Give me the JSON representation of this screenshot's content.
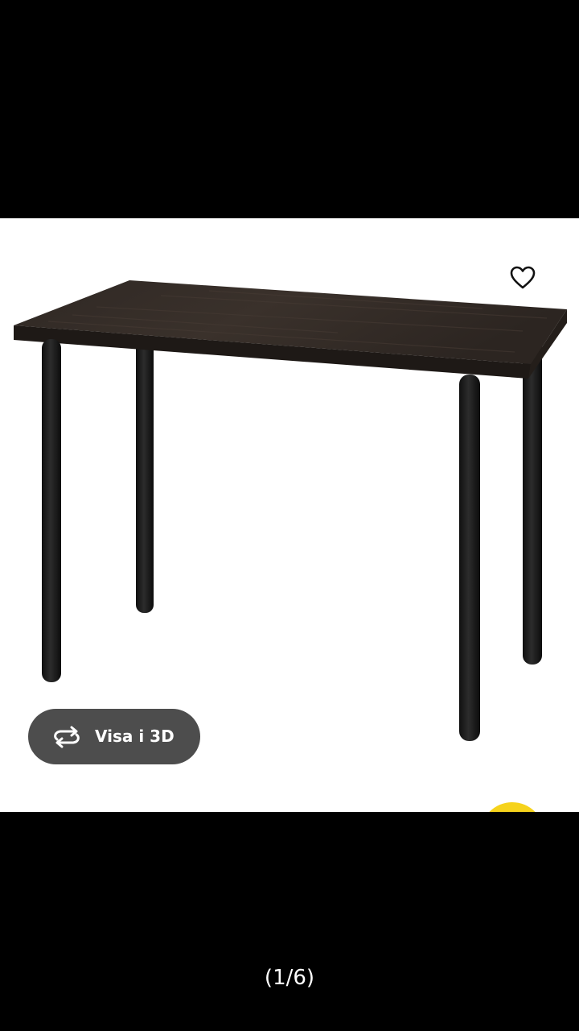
{
  "gallery": {
    "counter": "(1/6)",
    "view_3d_label": "Visa i 3D",
    "view_3d_icon": "rotate-3d-icon",
    "favorite_icon": "heart-outline-icon",
    "product_image": "black-brown-desk-with-black-legs"
  },
  "colors": {
    "background": "#000000",
    "image_panel": "#ffffff",
    "button_bg": "#4d4d4d",
    "button_text": "#ffffff",
    "accent_yellow": "#f6d31c",
    "table_top": "#2a2420",
    "legs": "#1f1f1f"
  }
}
